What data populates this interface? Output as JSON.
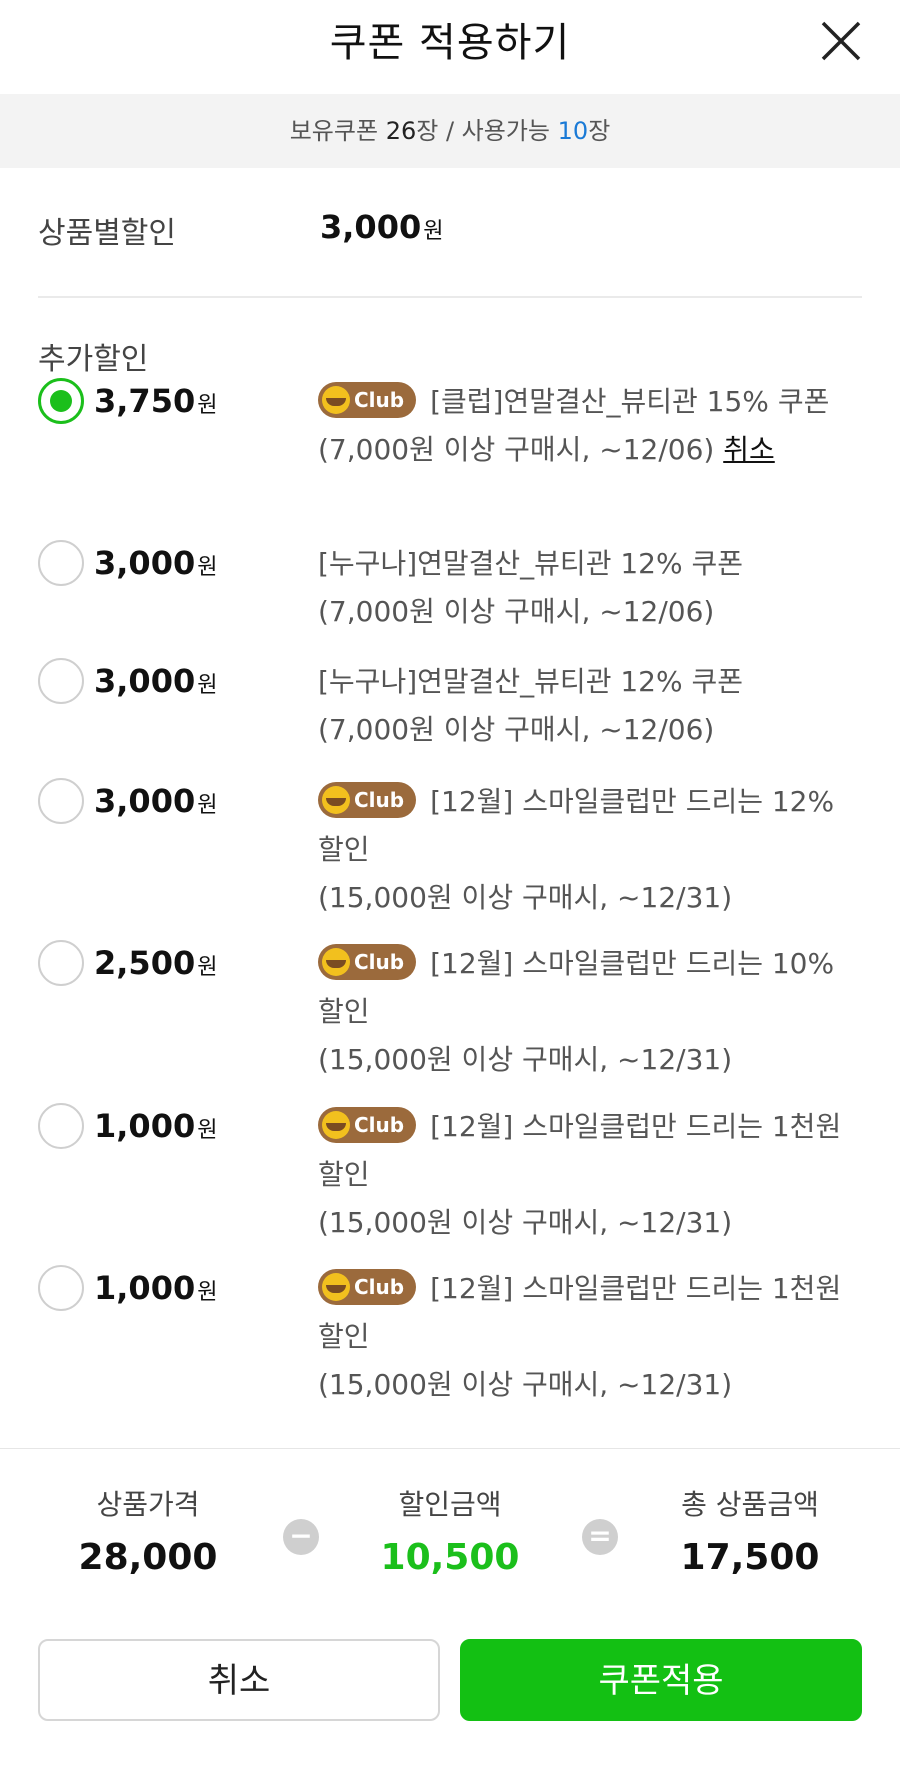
{
  "header": {
    "title": "쿠폰 적용하기",
    "close_icon": "close-icon"
  },
  "summary": {
    "owned_label": "보유쿠폰",
    "owned_count": "26",
    "owned_unit": "장",
    "sep": " / ",
    "usable_label": "사용가능",
    "usable_count": "10",
    "usable_unit": "장"
  },
  "product_discount": {
    "label": "상품별할인",
    "value": "3,000",
    "unit": "원"
  },
  "extra_discount": {
    "label": "추가할인"
  },
  "coupons": [
    {
      "amount": "3,750",
      "unit": "원",
      "checked": true,
      "club": true,
      "badge": "Club",
      "title": "[클럽]연말결산_뷰티관 15% 쿠폰",
      "condition": "(7,000원 이상 구매시, ~12/06)",
      "cancel": "취소"
    },
    {
      "amount": "3,000",
      "unit": "원",
      "checked": false,
      "club": false,
      "title": "[누구나]연말결산_뷰티관 12% 쿠폰",
      "condition": "(7,000원 이상 구매시, ~12/06)"
    },
    {
      "amount": "3,000",
      "unit": "원",
      "checked": false,
      "club": false,
      "title": "[누구나]연말결산_뷰티관 12% 쿠폰",
      "condition": "(7,000원 이상 구매시, ~12/06)"
    },
    {
      "amount": "3,000",
      "unit": "원",
      "checked": false,
      "club": true,
      "badge": "Club",
      "title": "[12월] 스마일클럽만 드리는 12% 할인",
      "condition": "(15,000원 이상 구매시, ~12/31)"
    },
    {
      "amount": "2,500",
      "unit": "원",
      "checked": false,
      "club": true,
      "badge": "Club",
      "title": "[12월] 스마일클럽만 드리는 10% 할인",
      "condition": "(15,000원 이상 구매시, ~12/31)"
    },
    {
      "amount": "1,000",
      "unit": "원",
      "checked": false,
      "club": true,
      "badge": "Club",
      "title": "[12월] 스마일클럽만 드리는 1천원 할인",
      "condition": "(15,000원 이상 구매시, ~12/31)"
    },
    {
      "amount": "1,000",
      "unit": "원",
      "checked": false,
      "club": true,
      "badge": "Club",
      "title": "[12월] 스마일클럽만 드리는 1천원 할인",
      "condition": "(15,000원 이상 구매시, ~12/31)"
    }
  ],
  "totals": {
    "price_label": "상품가격",
    "price_value": "28,000",
    "minus_op": "−",
    "discount_label": "할인금액",
    "discount_value": "10,500",
    "equals_op": "=",
    "total_label": "총 상품금액",
    "total_value": "17,500"
  },
  "buttons": {
    "cancel": "취소",
    "apply": "쿠폰적용"
  },
  "colors": {
    "accent": "#13c013",
    "blue": "#1a7ad6",
    "club_badge": "#9b6a3c"
  }
}
